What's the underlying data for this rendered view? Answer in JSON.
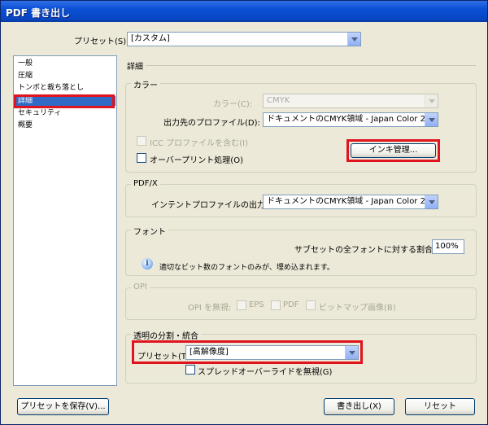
{
  "window": {
    "title": "PDF 書き出し"
  },
  "preset": {
    "label": "プリセット(S):",
    "value": "[カスタム]"
  },
  "sidebar": {
    "items": [
      {
        "label": "一般"
      },
      {
        "label": "圧縮"
      },
      {
        "label": "トンボと裁ち落とし"
      },
      {
        "label": "詳細"
      },
      {
        "label": "セキュリティ"
      },
      {
        "label": "概要"
      }
    ],
    "selected_index": 3
  },
  "section": {
    "title": "詳細"
  },
  "color_group": {
    "title": "カラー",
    "color_label": "カラー(C):",
    "color_value": "CMYK",
    "profile_label": "出力先のプロファイル(D):",
    "profile_value": "ドキュメントのCMYK領域 - Japan Color 2001",
    "icc_label": "ICC プロファイルを含む(I)",
    "overprint_label": "オーバープリント処理(O)",
    "ink_button": "インキ管理..."
  },
  "pdfx_group": {
    "title": "PDF/X",
    "intent_label": "インテントプロファイルの出力(U):",
    "intent_value": "ドキュメントのCMYK領域 - Japan Color 2001"
  },
  "font_group": {
    "title": "フォント",
    "subset_label": "サブセットの全フォントに対する割合(W):",
    "subset_value": "100%",
    "info_text": "適切なビット数のフォントのみが、埋め込まれます。"
  },
  "opi_group": {
    "title": "OPI",
    "omit_label": "OPI を無視:",
    "eps_label": "EPS",
    "pdf_label": "PDF",
    "bitmap_label": "ビットマップ画像(B)"
  },
  "transparency_group": {
    "title": "透明の分割・統合",
    "preset_label": "プリセット(T):",
    "preset_value": "[高解像度]",
    "spread_label": "スプレッドオーバーライドを無視(G)"
  },
  "footer": {
    "save_preset": "プリセットを保存(V)...",
    "export": "書き出し(X)",
    "reset": "リセット"
  }
}
